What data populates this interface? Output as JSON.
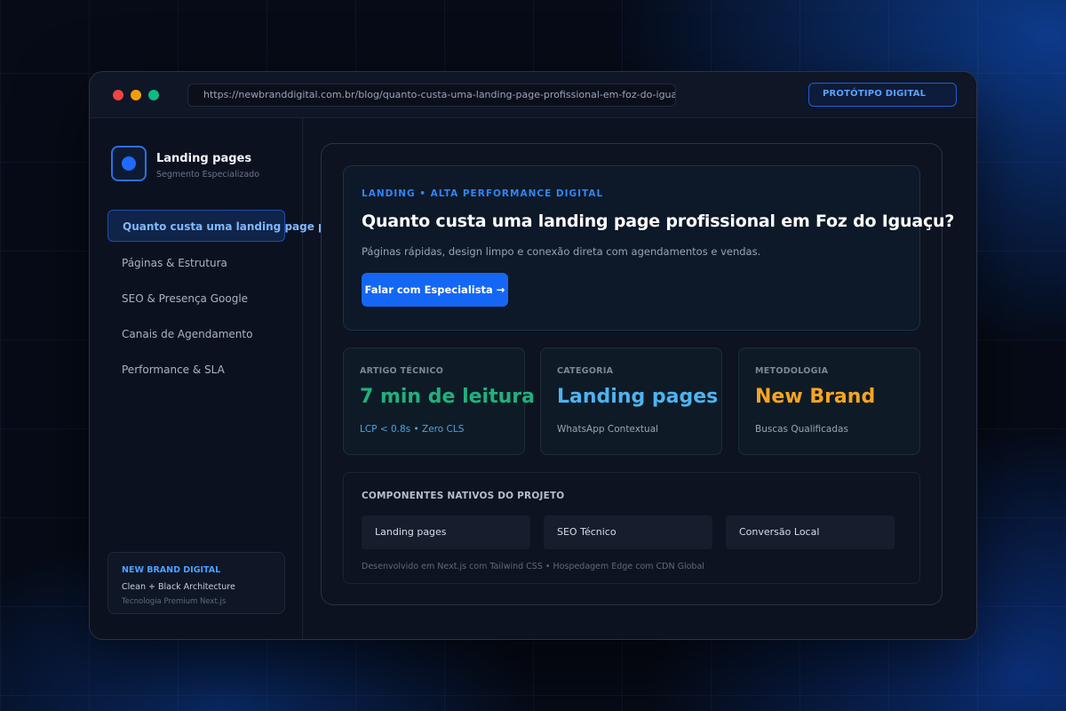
{
  "browser": {
    "url": "https://newbranddigital.com.br/blog/quanto-custa-uma-landing-page-profissional-em-foz-do-iguacu",
    "badge": "PROTÓTIPO DIGITAL"
  },
  "sidebar": {
    "brand_title": "Landing pages",
    "brand_subtitle": "Segmento Especializado",
    "items": [
      {
        "label": "Quanto custa uma landing page profissional em Foz do Iguaçu?",
        "active": true
      },
      {
        "label": "Páginas & Estrutura",
        "active": false
      },
      {
        "label": "SEO & Presença Google",
        "active": false
      },
      {
        "label": "Canais de Agendamento",
        "active": false
      },
      {
        "label": "Performance & SLA",
        "active": false
      }
    ],
    "footer": {
      "title": "NEW BRAND DIGITAL",
      "line1": "Clean + Black Architecture",
      "line2": "Tecnologia Premium Next.js"
    }
  },
  "hero": {
    "tag": "LANDING • ALTA PERFORMANCE DIGITAL",
    "title": "Quanto custa uma landing page profissional em Foz do Iguaçu?",
    "description": "Páginas rápidas, design limpo e conexão direta com agendamentos e vendas.",
    "cta_label": "Falar com Especialista →"
  },
  "stats": [
    {
      "label": "ARTIGO TÉCNICO",
      "value": "7 min de leitura",
      "sub": "LCP < 0.8s • Zero CLS",
      "value_color": "#22b07d",
      "sub_color": "#4ea3e0"
    },
    {
      "label": "CATEGORIA",
      "value": "Landing pages",
      "sub": "WhatsApp Contextual",
      "value_color": "#4fb3f0",
      "sub_color": "#9aa4b5"
    },
    {
      "label": "METODOLOGIA",
      "value": "New Brand",
      "sub": "Buscas Qualificadas",
      "value_color": "#f5a524",
      "sub_color": "#9aa4b5"
    }
  ],
  "components": {
    "title": "COMPONENTES NATIVOS DO PROJETO",
    "chips": [
      "Landing pages",
      "SEO Técnico",
      "Conversão Local"
    ],
    "footer": "Desenvolvido em Next.js com Tailwind CSS • Hospedagem Edge com CDN Global"
  }
}
